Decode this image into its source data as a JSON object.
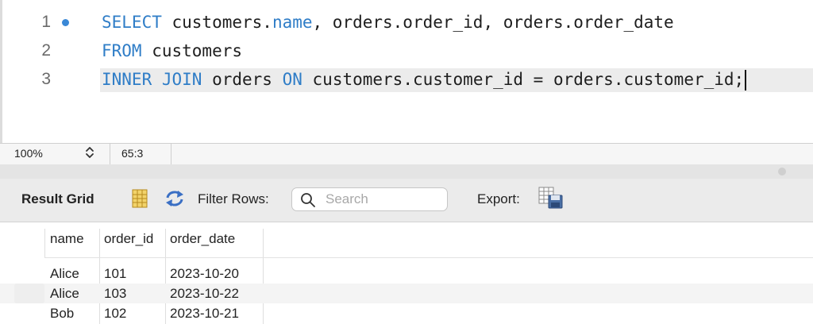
{
  "editor": {
    "lines": [
      {
        "number": "1",
        "kw1": "SELECT",
        "mid": " customers.",
        "kw2": "name",
        "rest": ", orders.order_id, orders.order_date"
      },
      {
        "number": "2",
        "kw1": "FROM",
        "rest": " customers"
      },
      {
        "number": "3",
        "kw1": "INNER JOIN",
        "mid": " orders ",
        "kw2": "ON",
        "rest": " customers.customer_id = orders.customer_id;"
      }
    ]
  },
  "status": {
    "zoom": "100%",
    "position": "65:3"
  },
  "result": {
    "title": "Result Grid",
    "filter_label": "Filter Rows:",
    "search_placeholder": "Search",
    "export_label": "Export:"
  },
  "grid": {
    "columns": [
      "name",
      "order_id",
      "order_date"
    ],
    "rows": [
      [
        "Alice",
        "101",
        "2023-10-20"
      ],
      [
        "Alice",
        "103",
        "2023-10-22"
      ],
      [
        "Bob",
        "102",
        "2023-10-21"
      ]
    ]
  },
  "colors": {
    "keyword": "#2f7dc7",
    "breakpoint": "#3a88d6",
    "line_highlight": "#ececec"
  },
  "icons": [
    "breakpoint-dot",
    "stepper-icon",
    "result-grid-icon",
    "refresh-icon",
    "search-icon",
    "export-icon"
  ]
}
